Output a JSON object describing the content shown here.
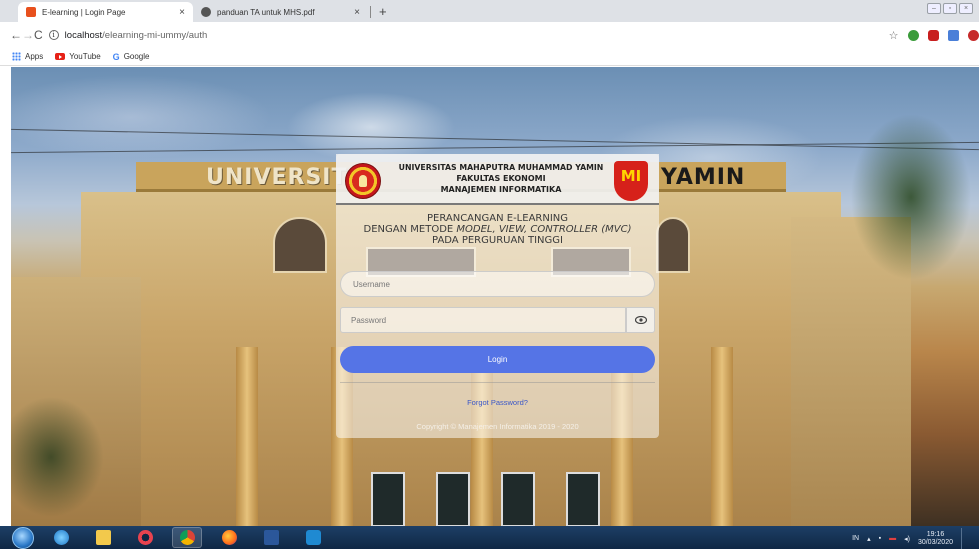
{
  "browser": {
    "tabs": [
      {
        "title": "E-learning | Login Page",
        "close": "×",
        "active": true,
        "favicon_color": "#e8501d"
      },
      {
        "title": "panduan TA untuk MHS.pdf",
        "close": "×",
        "active": false,
        "favicon_color": "#555555"
      }
    ],
    "new_tab": "+",
    "back": "←",
    "forward": "→",
    "reload": "C",
    "url_host": "localhost",
    "url_path": "/elearning-mi-ummy/auth",
    "bookmarks": [
      {
        "label": "Apps",
        "icon": "apps-grid-icon"
      },
      {
        "label": "YouTube",
        "icon": "youtube-icon"
      },
      {
        "label": "Google",
        "icon": "google-icon"
      }
    ]
  },
  "scene": {
    "sign_left": "UNIVERSITA",
    "sign_right": "YAMIN"
  },
  "login": {
    "org_line1": "UNIVERSITAS MAHAPUTRA MUHAMMAD YAMIN",
    "org_line2": "FAKULTAS EKONOMI",
    "org_line3": "MANAJEMEN INFORMATIKA",
    "logo_right_text": "MI",
    "title_line1": "PERANCANGAN E-LEARNING",
    "title_line2_prefix": "DENGAN METODE ",
    "title_line2_italic": "MODEL, VIEW, CONTROLLER (MVC)",
    "title_line3": "PADA PERGURUAN TINGGI",
    "username_placeholder": "Username",
    "username_value": "",
    "password_placeholder": "Password",
    "password_value": "",
    "login_label": "Login",
    "forgot_label": "Forgot Password?",
    "copyright": "Copyright © Manajemen Informatika 2019 - 2020",
    "accent_color": "#5574e6"
  },
  "taskbar": {
    "apps": [
      "windows-start",
      "internet-explorer",
      "file-explorer",
      "opera",
      "chrome",
      "firefox",
      "word",
      "vscode"
    ],
    "tray_lang": "IN",
    "time": "19:16",
    "date": "30/03/2020"
  }
}
